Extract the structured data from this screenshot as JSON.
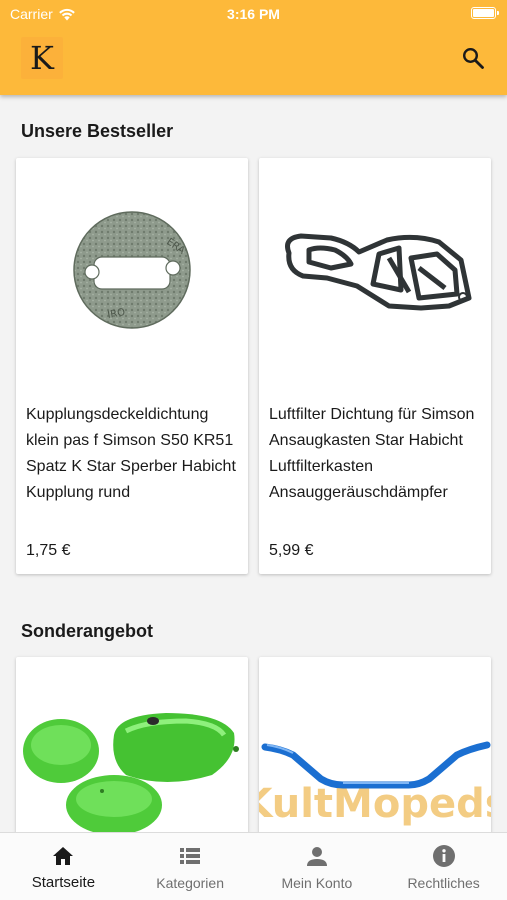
{
  "status_bar": {
    "carrier": "Carrier",
    "time": "3:16 PM"
  },
  "app_bar": {
    "logo_letter": "K",
    "brand_color": "#fdb93a",
    "search_icon": "search-icon"
  },
  "bestseller": {
    "heading": "Unsere Bestseller",
    "products": [
      {
        "title": "Kupplungsdeckeldichtung klein pas f Simson S50 KR51 Spatz K Star Sperber Habicht Kupplung rund",
        "price": "1,75 €",
        "image": "gasket-round-image"
      },
      {
        "title": "Luftfilter Dichtung für Simson Ansaugkasten Star Habicht Luftfilterkasten Ansauggeräuschdämpfer",
        "price": "5,99 €",
        "image": "gasket-airfilter-image"
      }
    ]
  },
  "special_offer": {
    "heading": "Sonderangebot",
    "products": [
      {
        "image": "green-tank-set-image"
      },
      {
        "image": "blue-handlebar-image",
        "watermark": "KultMopeds"
      }
    ]
  },
  "tab_bar": {
    "tabs": [
      {
        "label": "Startseite",
        "icon": "home-icon",
        "active": true
      },
      {
        "label": "Kategorien",
        "icon": "list-icon",
        "active": false
      },
      {
        "label": "Mein Konto",
        "icon": "person-icon",
        "active": false
      },
      {
        "label": "Rechtliches",
        "icon": "info-icon",
        "active": false
      }
    ]
  }
}
